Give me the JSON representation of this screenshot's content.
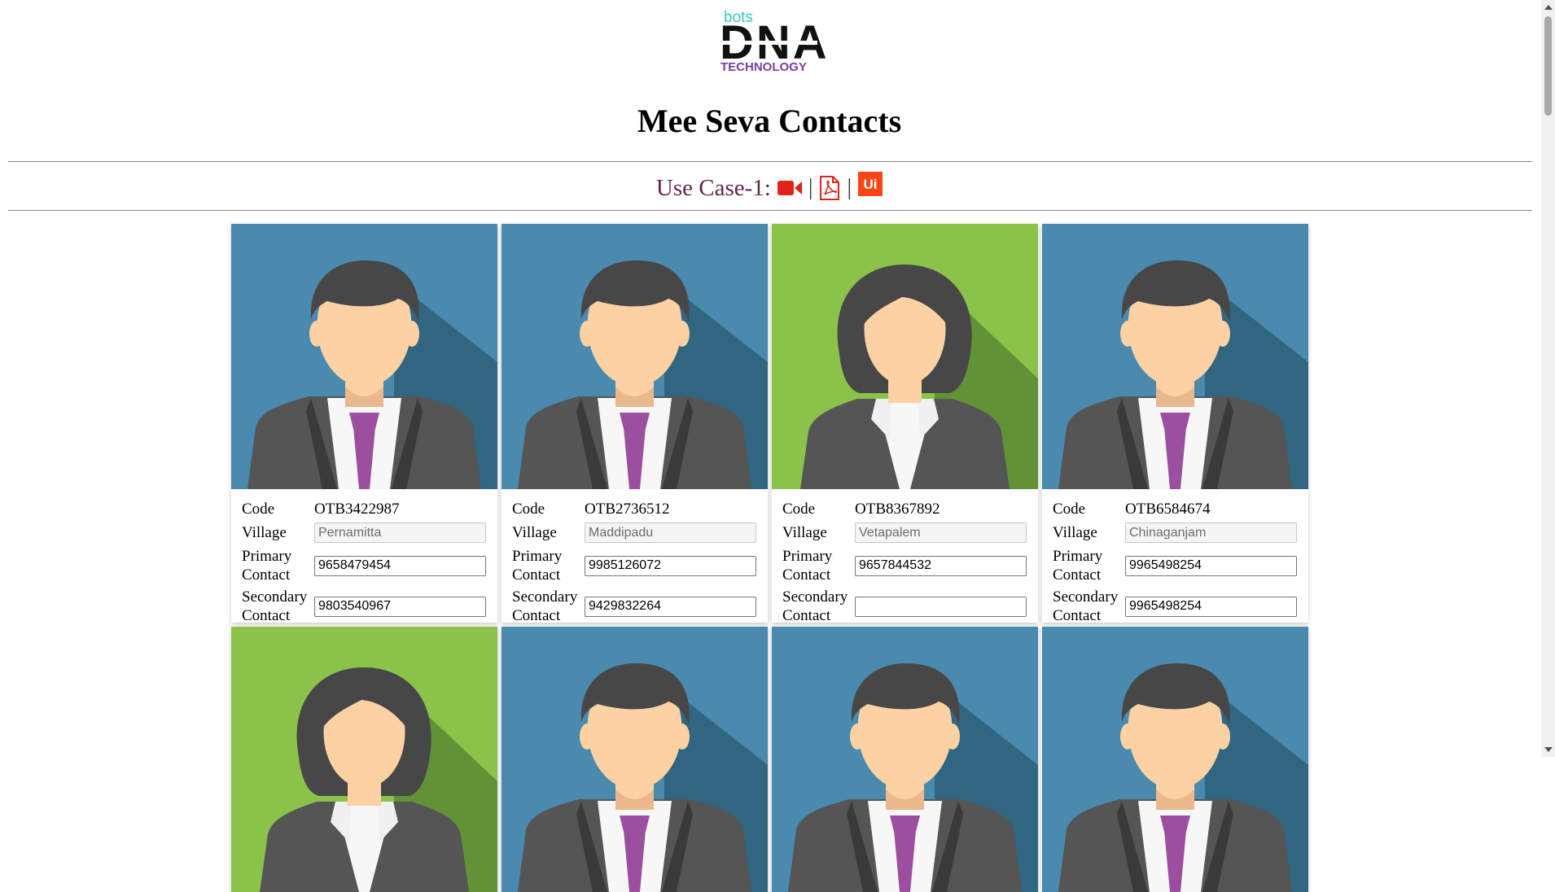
{
  "logo": {
    "line1": "bots",
    "line2": "DNA",
    "line3": "TECHNOLOGY"
  },
  "page_title": "Mee Seva Contacts",
  "usecase": {
    "label": "Use Case-1:",
    "separator": "|",
    "icons": [
      "video-camera-icon",
      "pdf-icon",
      "uipath-icon"
    ],
    "uipath_text": "Ui"
  },
  "field_labels": {
    "code": "Code",
    "village": "Village",
    "primary_line1": "Primary",
    "primary_line2": "Contact",
    "secondary_line1": "Secondary",
    "secondary_line2": "Contact"
  },
  "contacts": [
    {
      "avatar": "male",
      "bg": "#4a8aae",
      "code": "OTB3422987",
      "village": "Pernamitta",
      "primary": "9658479454",
      "secondary": "9803540967"
    },
    {
      "avatar": "male",
      "bg": "#4a8aae",
      "code": "OTB2736512",
      "village": "Maddipadu",
      "primary": "9985126072",
      "secondary": "9429832264"
    },
    {
      "avatar": "female",
      "bg": "#8bc34a",
      "code": "OTB8367892",
      "village": "Vetapalem",
      "primary": "9657844532",
      "secondary": ""
    },
    {
      "avatar": "male",
      "bg": "#4a8aae",
      "code": "OTB6584674",
      "village": "Chinaganjam",
      "primary": "9965498254",
      "secondary": "9965498254"
    }
  ],
  "next_row_avatars": [
    {
      "avatar": "female",
      "bg": "#8bc34a"
    },
    {
      "avatar": "male",
      "bg": "#4a8aae"
    },
    {
      "avatar": "male",
      "bg": "#4a8aae"
    },
    {
      "avatar": "male",
      "bg": "#4a8aae"
    }
  ],
  "colors": {
    "male_bg": "#4a8aae",
    "male_shadow": "#2b5f78",
    "female_bg": "#8bc34a",
    "female_shadow": "#5a8a32",
    "skin": "#fcd1a3",
    "hair": "#474747",
    "suit": "#555555",
    "tie": "#9b4f9e",
    "accent_red": "#e0241b",
    "uipath_orange": "#fa4616"
  }
}
